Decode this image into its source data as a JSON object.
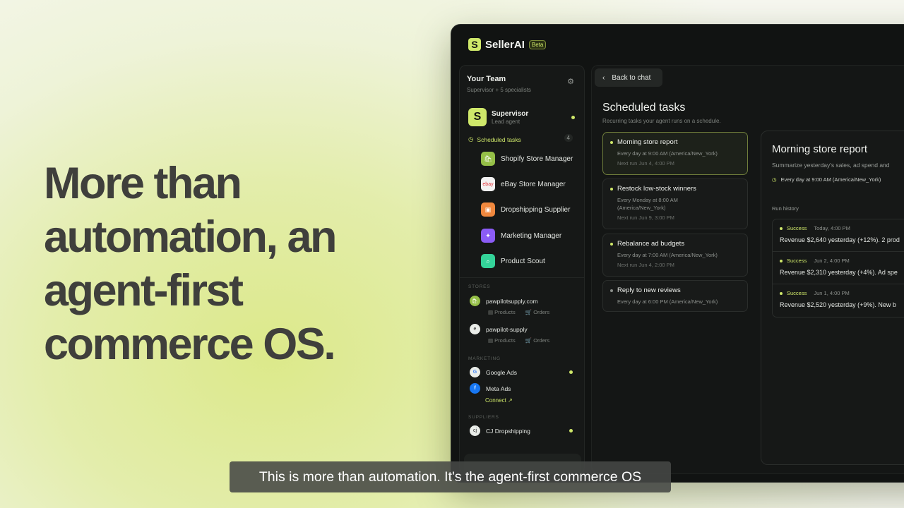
{
  "headline": "More than automation, an agent-first commerce OS.",
  "app": {
    "brand": "SellerAI",
    "beta_badge": "Beta",
    "sidebar": {
      "title": "Your Team",
      "subtitle": "Supervisor + 5 specialists",
      "supervisor": {
        "name": "Supervisor",
        "role": "Lead agent"
      },
      "scheduled_tasks": {
        "label": "Scheduled tasks",
        "count": "4"
      },
      "specialists": [
        {
          "label": "Shopify Store Manager",
          "icon": "shopify-icon",
          "color": "#95bf47"
        },
        {
          "label": "eBay Store Manager",
          "icon": "ebay-icon",
          "color": "#f2f2f2"
        },
        {
          "label": "Dropshipping Supplier",
          "icon": "box-icon",
          "color": "#f0883e"
        },
        {
          "label": "Marketing Manager",
          "icon": "megaphone-icon",
          "color": "#8b5cf6"
        },
        {
          "label": "Product Scout",
          "icon": "search-icon",
          "color": "#34d399"
        }
      ],
      "stores_heading": "STORES",
      "stores": [
        {
          "name": "pawpilotsupply.com",
          "products": "Products",
          "orders": "Orders"
        },
        {
          "name": "pawpilot-supply",
          "products": "Products",
          "orders": "Orders"
        }
      ],
      "marketing_heading": "MARKETING",
      "marketing": [
        {
          "name": "Google Ads"
        },
        {
          "name": "Meta Ads"
        }
      ],
      "connect_label": "Connect ↗",
      "suppliers_heading": "SUPPLIERS",
      "suppliers": [
        {
          "name": "CJ Dropshipping"
        }
      ]
    },
    "main": {
      "back_label": "Back to chat",
      "title": "Scheduled tasks",
      "subtitle": "Recurring tasks your agent runs on a schedule.",
      "tasks": [
        {
          "name": "Morning store report",
          "schedule": "Every day at 9:00 AM (America/New_York)",
          "next": "Next run Jun 4, 4:00 PM"
        },
        {
          "name": "Restock low-stock winners",
          "schedule": "Every Monday at 8:00 AM (America/New_York)",
          "next": "Next run Jun 9, 3:00 PM"
        },
        {
          "name": "Rebalance ad budgets",
          "schedule": "Every day at 7:00 AM (America/New_York)",
          "next": "Next run Jun 4, 2:00 PM"
        },
        {
          "name": "Reply to new reviews",
          "schedule": "Every day at 6:00 PM (America/New_York)",
          "next": ""
        }
      ],
      "detail": {
        "title": "Morning store report",
        "description": "Summarize yesterday's sales, ad spend and",
        "schedule": "Every day at 9:00 AM (America/New_York)",
        "history_label": "Run history",
        "runs": [
          {
            "status": "Success",
            "time": "Today, 4:00 PM",
            "summary": "Revenue $2,640 yesterday (+12%). 2 prod"
          },
          {
            "status": "Success",
            "time": "Jun 2, 4:00 PM",
            "summary": "Revenue $2,310 yesterday (+4%). Ad spe"
          },
          {
            "status": "Success",
            "time": "Jun 1, 4:00 PM",
            "summary": "Revenue $2,520 yesterday (+9%). New b"
          }
        ]
      }
    }
  },
  "caption": "This is more than automation. It's the agent-first commerce OS"
}
